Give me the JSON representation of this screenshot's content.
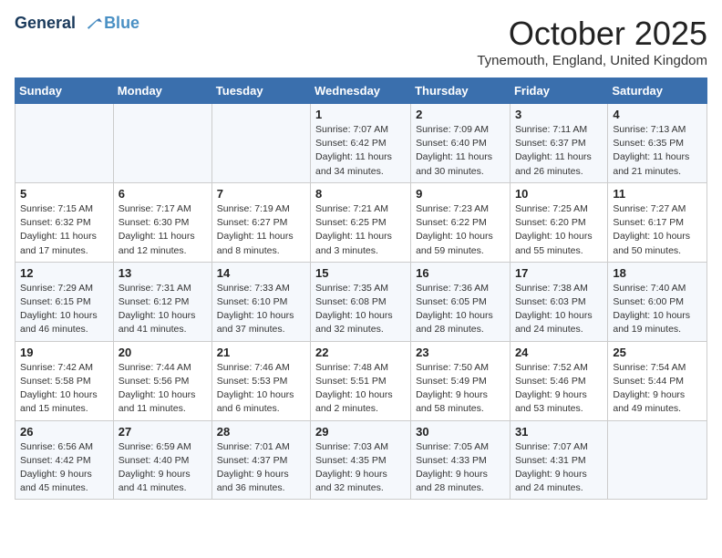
{
  "logo": {
    "line1": "General",
    "line2": "Blue"
  },
  "title": "October 2025",
  "subtitle": "Tynemouth, England, United Kingdom",
  "headers": [
    "Sunday",
    "Monday",
    "Tuesday",
    "Wednesday",
    "Thursday",
    "Friday",
    "Saturday"
  ],
  "weeks": [
    [
      {
        "day": "",
        "info": ""
      },
      {
        "day": "",
        "info": ""
      },
      {
        "day": "",
        "info": ""
      },
      {
        "day": "1",
        "info": "Sunrise: 7:07 AM\nSunset: 6:42 PM\nDaylight: 11 hours and 34 minutes."
      },
      {
        "day": "2",
        "info": "Sunrise: 7:09 AM\nSunset: 6:40 PM\nDaylight: 11 hours and 30 minutes."
      },
      {
        "day": "3",
        "info": "Sunrise: 7:11 AM\nSunset: 6:37 PM\nDaylight: 11 hours and 26 minutes."
      },
      {
        "day": "4",
        "info": "Sunrise: 7:13 AM\nSunset: 6:35 PM\nDaylight: 11 hours and 21 minutes."
      }
    ],
    [
      {
        "day": "5",
        "info": "Sunrise: 7:15 AM\nSunset: 6:32 PM\nDaylight: 11 hours and 17 minutes."
      },
      {
        "day": "6",
        "info": "Sunrise: 7:17 AM\nSunset: 6:30 PM\nDaylight: 11 hours and 12 minutes."
      },
      {
        "day": "7",
        "info": "Sunrise: 7:19 AM\nSunset: 6:27 PM\nDaylight: 11 hours and 8 minutes."
      },
      {
        "day": "8",
        "info": "Sunrise: 7:21 AM\nSunset: 6:25 PM\nDaylight: 11 hours and 3 minutes."
      },
      {
        "day": "9",
        "info": "Sunrise: 7:23 AM\nSunset: 6:22 PM\nDaylight: 10 hours and 59 minutes."
      },
      {
        "day": "10",
        "info": "Sunrise: 7:25 AM\nSunset: 6:20 PM\nDaylight: 10 hours and 55 minutes."
      },
      {
        "day": "11",
        "info": "Sunrise: 7:27 AM\nSunset: 6:17 PM\nDaylight: 10 hours and 50 minutes."
      }
    ],
    [
      {
        "day": "12",
        "info": "Sunrise: 7:29 AM\nSunset: 6:15 PM\nDaylight: 10 hours and 46 minutes."
      },
      {
        "day": "13",
        "info": "Sunrise: 7:31 AM\nSunset: 6:12 PM\nDaylight: 10 hours and 41 minutes."
      },
      {
        "day": "14",
        "info": "Sunrise: 7:33 AM\nSunset: 6:10 PM\nDaylight: 10 hours and 37 minutes."
      },
      {
        "day": "15",
        "info": "Sunrise: 7:35 AM\nSunset: 6:08 PM\nDaylight: 10 hours and 32 minutes."
      },
      {
        "day": "16",
        "info": "Sunrise: 7:36 AM\nSunset: 6:05 PM\nDaylight: 10 hours and 28 minutes."
      },
      {
        "day": "17",
        "info": "Sunrise: 7:38 AM\nSunset: 6:03 PM\nDaylight: 10 hours and 24 minutes."
      },
      {
        "day": "18",
        "info": "Sunrise: 7:40 AM\nSunset: 6:00 PM\nDaylight: 10 hours and 19 minutes."
      }
    ],
    [
      {
        "day": "19",
        "info": "Sunrise: 7:42 AM\nSunset: 5:58 PM\nDaylight: 10 hours and 15 minutes."
      },
      {
        "day": "20",
        "info": "Sunrise: 7:44 AM\nSunset: 5:56 PM\nDaylight: 10 hours and 11 minutes."
      },
      {
        "day": "21",
        "info": "Sunrise: 7:46 AM\nSunset: 5:53 PM\nDaylight: 10 hours and 6 minutes."
      },
      {
        "day": "22",
        "info": "Sunrise: 7:48 AM\nSunset: 5:51 PM\nDaylight: 10 hours and 2 minutes."
      },
      {
        "day": "23",
        "info": "Sunrise: 7:50 AM\nSunset: 5:49 PM\nDaylight: 9 hours and 58 minutes."
      },
      {
        "day": "24",
        "info": "Sunrise: 7:52 AM\nSunset: 5:46 PM\nDaylight: 9 hours and 53 minutes."
      },
      {
        "day": "25",
        "info": "Sunrise: 7:54 AM\nSunset: 5:44 PM\nDaylight: 9 hours and 49 minutes."
      }
    ],
    [
      {
        "day": "26",
        "info": "Sunrise: 6:56 AM\nSunset: 4:42 PM\nDaylight: 9 hours and 45 minutes."
      },
      {
        "day": "27",
        "info": "Sunrise: 6:59 AM\nSunset: 4:40 PM\nDaylight: 9 hours and 41 minutes."
      },
      {
        "day": "28",
        "info": "Sunrise: 7:01 AM\nSunset: 4:37 PM\nDaylight: 9 hours and 36 minutes."
      },
      {
        "day": "29",
        "info": "Sunrise: 7:03 AM\nSunset: 4:35 PM\nDaylight: 9 hours and 32 minutes."
      },
      {
        "day": "30",
        "info": "Sunrise: 7:05 AM\nSunset: 4:33 PM\nDaylight: 9 hours and 28 minutes."
      },
      {
        "day": "31",
        "info": "Sunrise: 7:07 AM\nSunset: 4:31 PM\nDaylight: 9 hours and 24 minutes."
      },
      {
        "day": "",
        "info": ""
      }
    ]
  ]
}
